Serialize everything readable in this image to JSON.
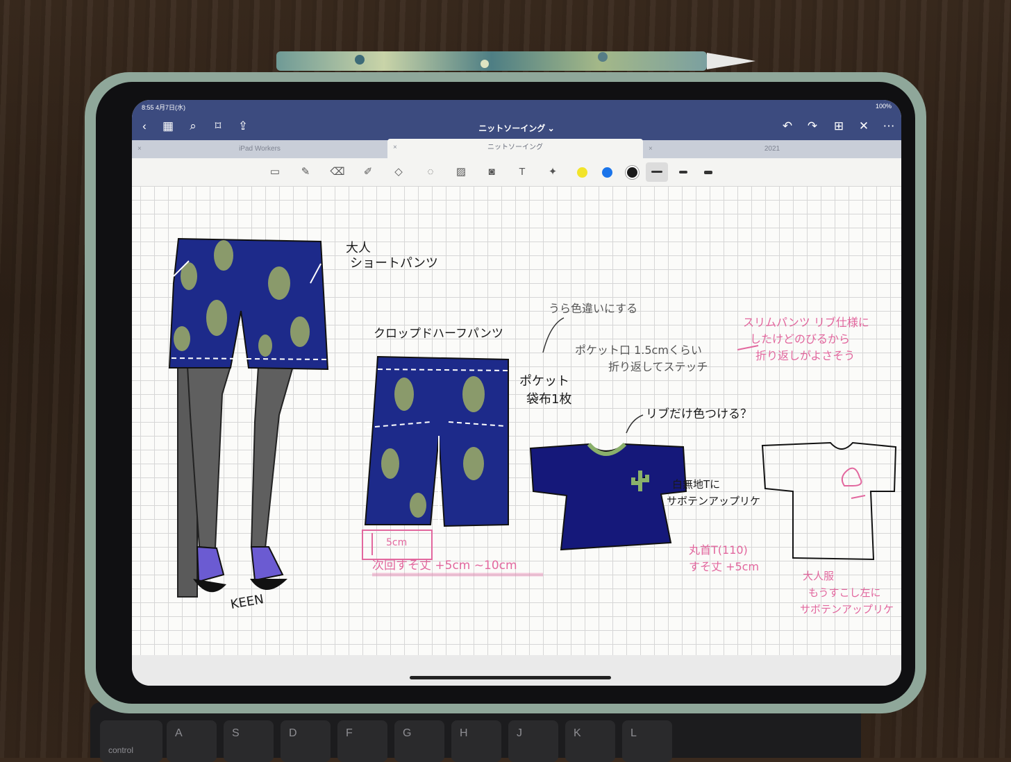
{
  "status_bar": {
    "time": "8:55 4月7日(水)",
    "battery": "100%"
  },
  "nav": {
    "title": "ニットソーイング ⌄"
  },
  "tabs": [
    {
      "label": "iPad Workers"
    },
    {
      "label": "ニットソーイング"
    },
    {
      "label": "2021"
    }
  ],
  "toolbar": {
    "colors": [
      "#f2e42a",
      "#1a74ea",
      "#1a1a1a"
    ]
  },
  "notes": {
    "adult_label": "大人",
    "adult_shorts": "ショートパンツ",
    "cropped_half": "クロップドハーフパンツ",
    "urara": "うら色違いにする",
    "pocket": "ポケット",
    "pocket_cloth": "袋布1枚",
    "pocket_fold_1": "ポケット口 1.5cmくらい",
    "pocket_fold_2": "折り返してステッチ",
    "slim_1": "スリムパンツ リブ仕様に",
    "slim_2": "したけどのびるから",
    "slim_3": "折り返しがよさそう",
    "rib_color": "リブだけ色つける？",
    "white_t_1": "白無地Tに",
    "white_t_2": "サボテンアップリケ",
    "marukubi_1": "丸首T(110)",
    "marukubi_2": "すそ丈 +5cm",
    "adult_clothes_1": "大人服",
    "adult_clothes_2": "もうすこし左に",
    "adult_clothes_3": "サボテンアップリケ",
    "five_cm": "5cm",
    "next_time": "次回すそ丈 +5cm ~10cm",
    "keen": "KEEN"
  },
  "keyboard": {
    "control": "control",
    "keys": [
      "A",
      "S",
      "D",
      "F",
      "G",
      "H",
      "J",
      "K",
      "L"
    ]
  }
}
